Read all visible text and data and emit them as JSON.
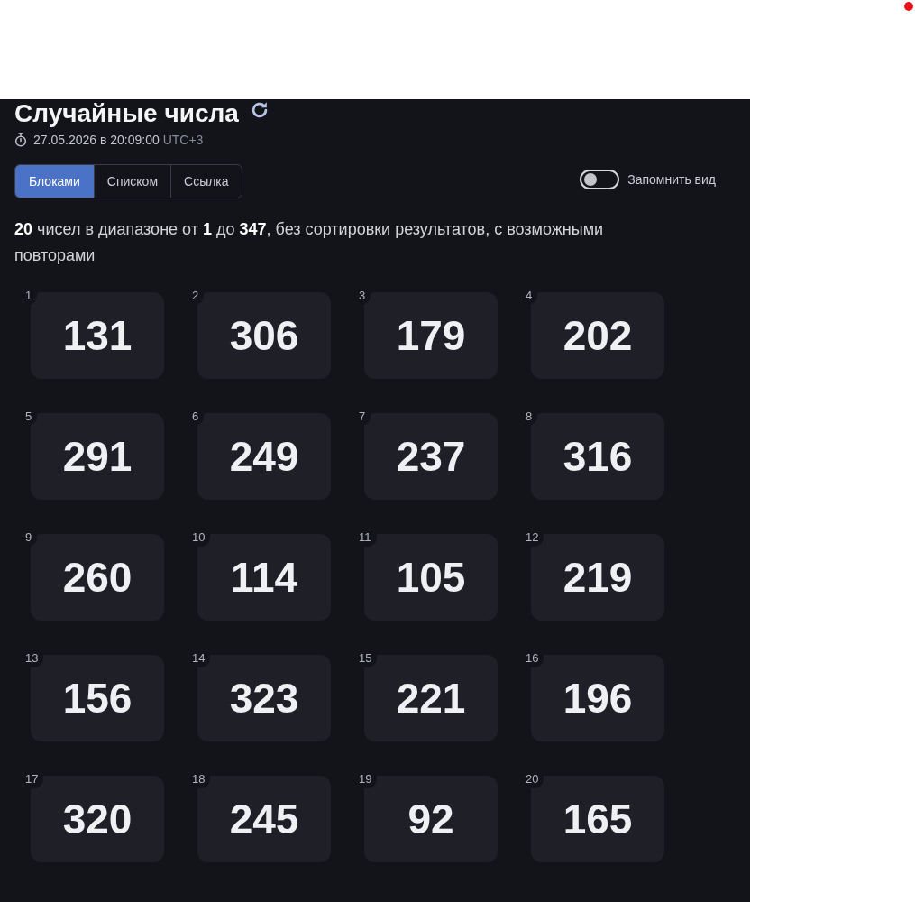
{
  "title": "Случайные числа",
  "timestamp": {
    "datetime": "27.05.2026 в 20:09:00",
    "timezone": "UTC+3"
  },
  "view_tabs": [
    {
      "label": "Блоками",
      "selected": true
    },
    {
      "label": "Списком",
      "selected": false
    },
    {
      "label": "Ссылка",
      "selected": false
    }
  ],
  "remember_view": {
    "label": "Запомнить вид",
    "on": false
  },
  "summary": "**20** чисел в диапазоне от **1** до **347**, без сортировки результатов, с возможными повторами",
  "numbers": [
    {
      "index": "1",
      "value": "131"
    },
    {
      "index": "2",
      "value": "306"
    },
    {
      "index": "3",
      "value": "179"
    },
    {
      "index": "4",
      "value": "202"
    },
    {
      "index": "5",
      "value": "291"
    },
    {
      "index": "6",
      "value": "249"
    },
    {
      "index": "7",
      "value": "237"
    },
    {
      "index": "8",
      "value": "316"
    },
    {
      "index": "9",
      "value": "260"
    },
    {
      "index": "10",
      "value": "114"
    },
    {
      "index": "11",
      "value": "105"
    },
    {
      "index": "12",
      "value": "219"
    },
    {
      "index": "13",
      "value": "156"
    },
    {
      "index": "14",
      "value": "323"
    },
    {
      "index": "15",
      "value": "221"
    },
    {
      "index": "16",
      "value": "196"
    },
    {
      "index": "17",
      "value": "320"
    },
    {
      "index": "18",
      "value": "245"
    },
    {
      "index": "19",
      "value": "92"
    },
    {
      "index": "20",
      "value": "165"
    }
  ]
}
